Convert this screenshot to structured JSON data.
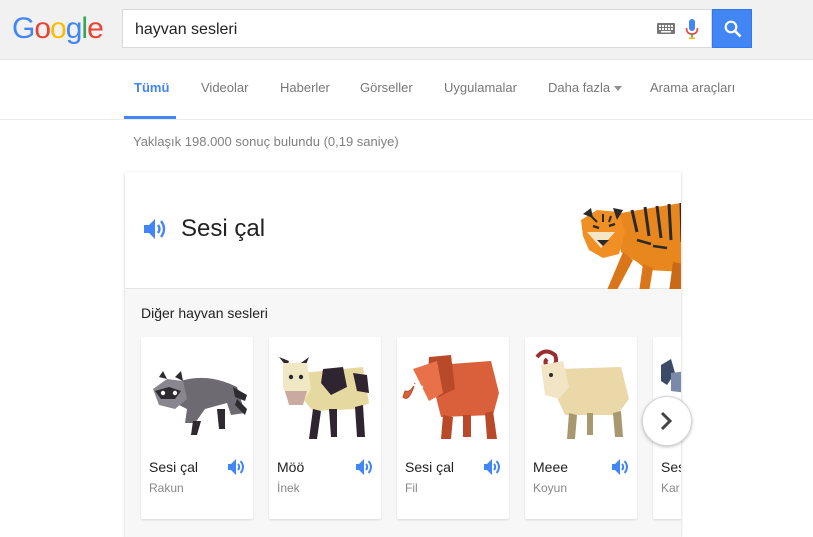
{
  "logo": {
    "letters": [
      "G",
      "o",
      "o",
      "g",
      "l",
      "e"
    ],
    "colors": [
      "#4285f4",
      "#ea4335",
      "#fbbc05",
      "#4285f4",
      "#34a853",
      "#ea4335"
    ]
  },
  "search": {
    "query": "hayvan sesleri"
  },
  "icons": {
    "keyboard": "keyboard-icon",
    "mic": "mic-icon",
    "search": "search-icon",
    "speaker": "speaker-icon",
    "next": "chevron-right-icon"
  },
  "tabs": [
    {
      "label": "Tümü",
      "active": true
    },
    {
      "label": "Videolar"
    },
    {
      "label": "Haberler"
    },
    {
      "label": "Görseller"
    },
    {
      "label": "Uygulamalar"
    },
    {
      "label": "Daha fazla"
    },
    {
      "label": "Arama araçları"
    }
  ],
  "stats": "Yaklaşık 198.000 sonuç bulundu (0,19 saniye)",
  "card": {
    "play_label": "Sesi çal",
    "more_title": "Diğer hayvan sesleri",
    "animals": [
      {
        "label": "Sesi çal",
        "sub": "Rakun"
      },
      {
        "label": "Möö",
        "sub": "İnek"
      },
      {
        "label": "Sesi çal",
        "sub": "Fil"
      },
      {
        "label": "Meee",
        "sub": "Koyun"
      },
      {
        "label": "Ses",
        "sub": "Kar"
      }
    ]
  },
  "colors": {
    "accent": "#4285f4"
  }
}
